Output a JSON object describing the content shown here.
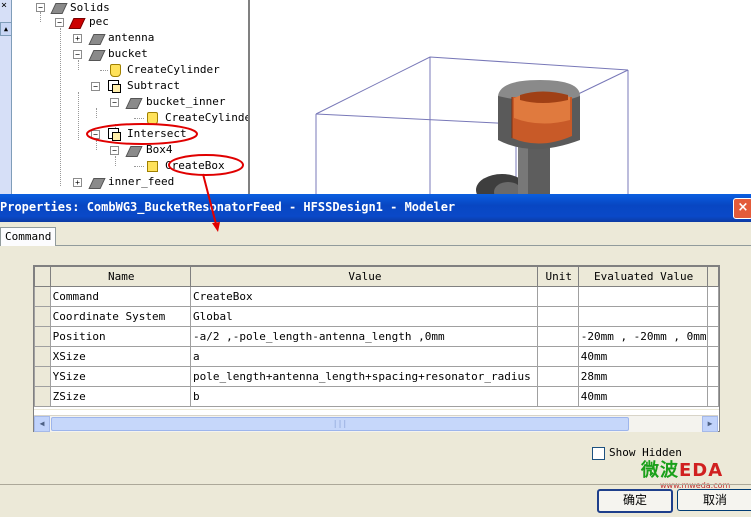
{
  "tree": {
    "items": [
      {
        "label": "Solids"
      },
      {
        "label": "pec"
      },
      {
        "label": "antenna"
      },
      {
        "label": "bucket"
      },
      {
        "label": "CreateCylinder"
      },
      {
        "label": "Subtract"
      },
      {
        "label": "bucket_inner"
      },
      {
        "label": "CreateCylinde"
      },
      {
        "label": "Intersect"
      },
      {
        "label": "Box4"
      },
      {
        "label": "CreateBox"
      },
      {
        "label": "inner_feed"
      }
    ],
    "left_strip_close": "×"
  },
  "dialog": {
    "title": "Properties: CombWG3_BucketResonatorFeed - HFSSDesign1 - Modeler",
    "close_label": "×",
    "tab": "Command",
    "table": {
      "headers": [
        "Name",
        "Value",
        "Unit",
        "Evaluated Value"
      ],
      "rows": [
        {
          "name": "Command",
          "value": "CreateBox",
          "unit": "",
          "evaluated": ""
        },
        {
          "name": "Coordinate System",
          "value": "Global",
          "unit": "",
          "evaluated": ""
        },
        {
          "name": "Position",
          "value": "-a/2 ,-pole_length-antenna_length ,0mm",
          "unit": "",
          "evaluated": "-20mm , -20mm , 0mm"
        },
        {
          "name": "XSize",
          "value": "a",
          "unit": "",
          "evaluated": "40mm"
        },
        {
          "name": "YSize",
          "value": "pole_length+antenna_length+spacing+resonator_radius",
          "unit": "",
          "evaluated": "28mm"
        },
        {
          "name": "ZSize",
          "value": "b",
          "unit": "",
          "evaluated": "40mm"
        }
      ]
    },
    "show_hidden": "Show Hidden",
    "ok": "确定",
    "cancel": "取消"
  },
  "watermark": {
    "text_a": "微波",
    "text_b": "EDA",
    "url": "www.mweda.com"
  },
  "colors": {
    "titlebar": "#0a49c8",
    "annotation": "#e00000",
    "model_orange": "#c85a28",
    "model_gray": "#5a5a5a"
  }
}
